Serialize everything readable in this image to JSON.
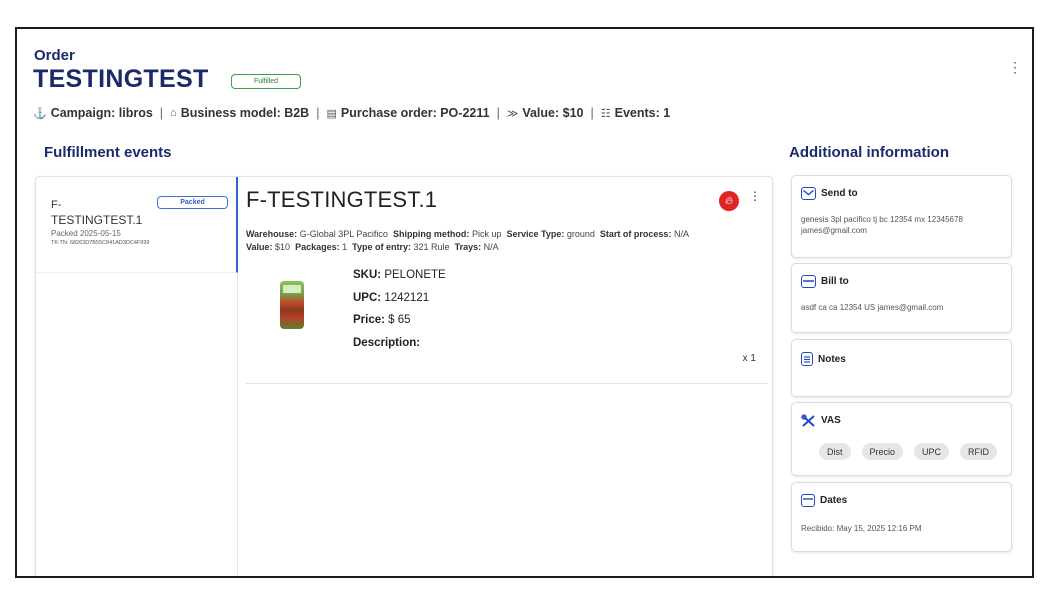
{
  "header": {
    "order_label": "Order",
    "order_id": "TESTINGTEST",
    "status": "Fulfilled",
    "meta": [
      {
        "icon": "campaign-icon",
        "glyph": "⚓",
        "text": "Campaign: libros"
      },
      {
        "icon": "business-icon",
        "glyph": "⌂",
        "text": "Business model: B2B"
      },
      {
        "icon": "document-icon",
        "glyph": "▤",
        "text": "Purchase order: PO-2211"
      },
      {
        "icon": "value-icon",
        "glyph": "≫",
        "text": "Value: $10"
      },
      {
        "icon": "events-icon",
        "glyph": "☷",
        "text": "Events: 1"
      }
    ]
  },
  "fulfillment": {
    "title": "Fulfillment events",
    "event": {
      "prefix": "F-",
      "id": "TESTINGTEST.1",
      "status": "Packed",
      "packed_date": "Packed 2025-05-15",
      "tracking": "TK:TN: 68263D7B55C841AD3DC4F999"
    },
    "detail": {
      "title": "F-TESTINGTEST.1",
      "info1": [
        {
          "label": "Warehouse:",
          "value": "G-Global 3PL Pacifico"
        },
        {
          "label": "Shipping method:",
          "value": "Pick up"
        },
        {
          "label": "Service Type:",
          "value": "ground"
        },
        {
          "label": "Start of process:",
          "value": "N/A"
        }
      ],
      "info2": [
        {
          "label": "Value:",
          "value": "$10"
        },
        {
          "label": "Packages:",
          "value": "1"
        },
        {
          "label": "Type of entry:",
          "value": "321 Rule"
        },
        {
          "label": "Trays:",
          "value": "N/A"
        }
      ],
      "product": {
        "sku_label": "SKU:",
        "sku": "PELONETE",
        "upc_label": "UPC:",
        "upc": "1242121",
        "price_label": "Price:",
        "price": "$ 65",
        "desc_label": "Description:",
        "desc": "",
        "qty": "x 1"
      }
    }
  },
  "additional": {
    "title": "Additional information",
    "send_to": {
      "title": "Send to",
      "body": "genesis 3pl pacifico tj bc 12354 mx 12345678 james@gmail.com"
    },
    "bill_to": {
      "title": "Bill to",
      "body": "asdf ca ca 12354 US james@gmail.com"
    },
    "notes": {
      "title": "Notes",
      "body": ""
    },
    "vas": {
      "title": "VAS",
      "chips": [
        "Dist",
        "Precio",
        "UPC",
        "RFID"
      ]
    },
    "dates": {
      "title": "Dates",
      "body": "Recibido: May 15, 2025 12:16 PM"
    }
  },
  "colors": {
    "brand": "#1b2a6b",
    "accent": "#2f63d0",
    "fulfilled": "#3aa14a",
    "fire": "#e02323"
  }
}
